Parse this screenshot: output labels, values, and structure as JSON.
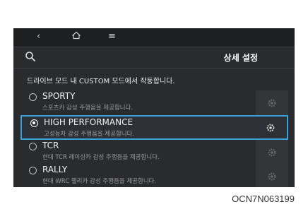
{
  "header": {
    "title": "상세 설정"
  },
  "description": "드라이브 모드 내 CUSTOM 모드에서 작동합니다.",
  "icons": {
    "back": "back-icon",
    "home": "home-icon",
    "menu": "menu-icon",
    "search": "search-icon",
    "settings": "gear-icon"
  },
  "modes": [
    {
      "name": "SPORTY",
      "desc": "스포츠카 감성 주행음을 제공합니다.",
      "selected": false
    },
    {
      "name": "HIGH PERFORMANCE",
      "desc": "고성능차 감성 주행음을 제공합니다.",
      "selected": true
    },
    {
      "name": "TCR",
      "desc": "현대 TCR 레이싱카 감성 주행음을 제공합니다.",
      "selected": false
    },
    {
      "name": "RALLY",
      "desc": "현대 WRC 랠리카 감성 주행음을 제공합니다.",
      "selected": false
    }
  ],
  "colors": {
    "accent": "#3aa0d8",
    "screen_bg": "#2a2b2d"
  },
  "caption": "OCN7N063199"
}
